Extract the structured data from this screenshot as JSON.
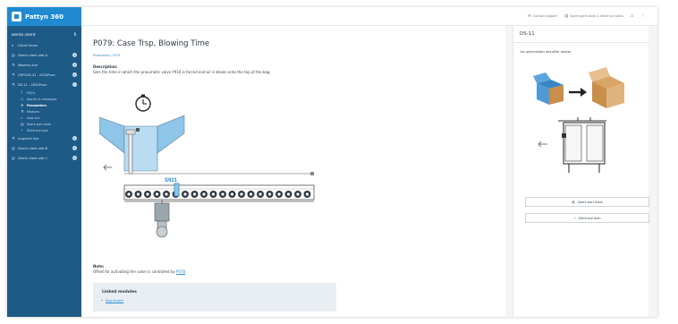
{
  "brand": {
    "name": "Pattyn 360"
  },
  "sidebar": {
    "client": "Demo client",
    "items": [
      {
        "icon": "⌂",
        "label": "Client Home"
      },
      {
        "icon": "▥",
        "label": "Demo client site A"
      },
      {
        "icon": "⚗",
        "label": "Mastery line"
      },
      {
        "icon": "⚗",
        "label": "CDPLED-41 - 2020Pxxx"
      },
      {
        "icon": "⚗",
        "label": "DS-11 - 2020Pxxx"
      }
    ],
    "subitems": [
      {
        "icon": "?",
        "label": "FAQ's"
      },
      {
        "icon": "⚠",
        "label": "Alarms & messages"
      },
      {
        "icon": "≡",
        "label": "Parameters"
      },
      {
        "icon": "⚗",
        "label": "Modules"
      },
      {
        "icon": "⌕",
        "label": "How to's"
      },
      {
        "icon": "▤",
        "label": "Spare part book"
      },
      {
        "icon": "⚡",
        "label": "Electrical plan"
      }
    ],
    "items_after": [
      {
        "icon": "⚗",
        "label": "Augustin line"
      },
      {
        "icon": "▥",
        "label": "Demo client site B"
      },
      {
        "icon": "▥",
        "label": "Demo client site C"
      }
    ]
  },
  "topbar": {
    "contact": "Contact support",
    "spare": "Spare parts book & electrical plans"
  },
  "main": {
    "title": "P079: Case Trsp, Blowing Time",
    "breadcrumb": "Parameters / P079",
    "description_heading": "Description:",
    "description": "Sets the time in which the pneumatic valve Y910 is forced and air is blown onto the top of the bag.",
    "machine_label": "S921",
    "note_heading": "Note:",
    "note_text": "Offset for activating the valve is controlled by",
    "note_link": "P078",
    "linked_heading": "Linked modules",
    "linked_item": "Bag blower"
  },
  "right_panel": {
    "title": "DS-11",
    "description": "1st generation decuffer sealer",
    "button_spare": "Spare part book",
    "button_electrical": "Electrical plan"
  },
  "colors": {
    "sidebar": "#1e5a86",
    "brand": "#1f8ad2",
    "accent": "#2a8ad0",
    "conveyor": "#2f3b44",
    "hopper": "#8ec5e8"
  }
}
